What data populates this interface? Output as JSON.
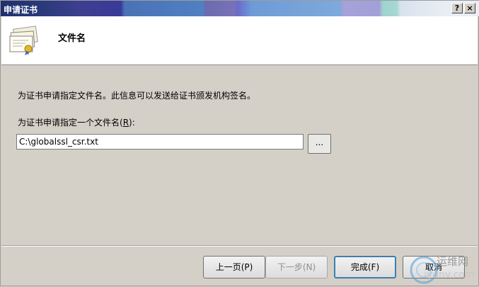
{
  "window": {
    "title": "申请证书",
    "help_label": "?",
    "close_label": "×"
  },
  "header": {
    "title": "文件名"
  },
  "main": {
    "description": "为证书申请指定文件名。此信息可以发送给证书颁发机构签名。",
    "field_label_prefix": "为证书申请指定一个文件名(",
    "field_label_hotkey": "R",
    "field_label_suffix": "):",
    "filename_value": "C:\\globalssl_csr.txt",
    "browse_label": "..."
  },
  "footer": {
    "back_label": "上一页(P)",
    "next_label": "下一步(N)",
    "finish_label": "完成(F)",
    "cancel_label": "取消"
  },
  "watermark": {
    "line1": "运维网",
    "line2": "iyunv.com"
  },
  "colors": {
    "dialog_bg": "#d4d0c8",
    "header_bg": "#ffffff",
    "title_text": "#ffffff",
    "default_button_border": "#3c7fb1",
    "disabled_text": "#8e8e8e"
  },
  "icons": {
    "header": "certificate-stack-icon"
  }
}
